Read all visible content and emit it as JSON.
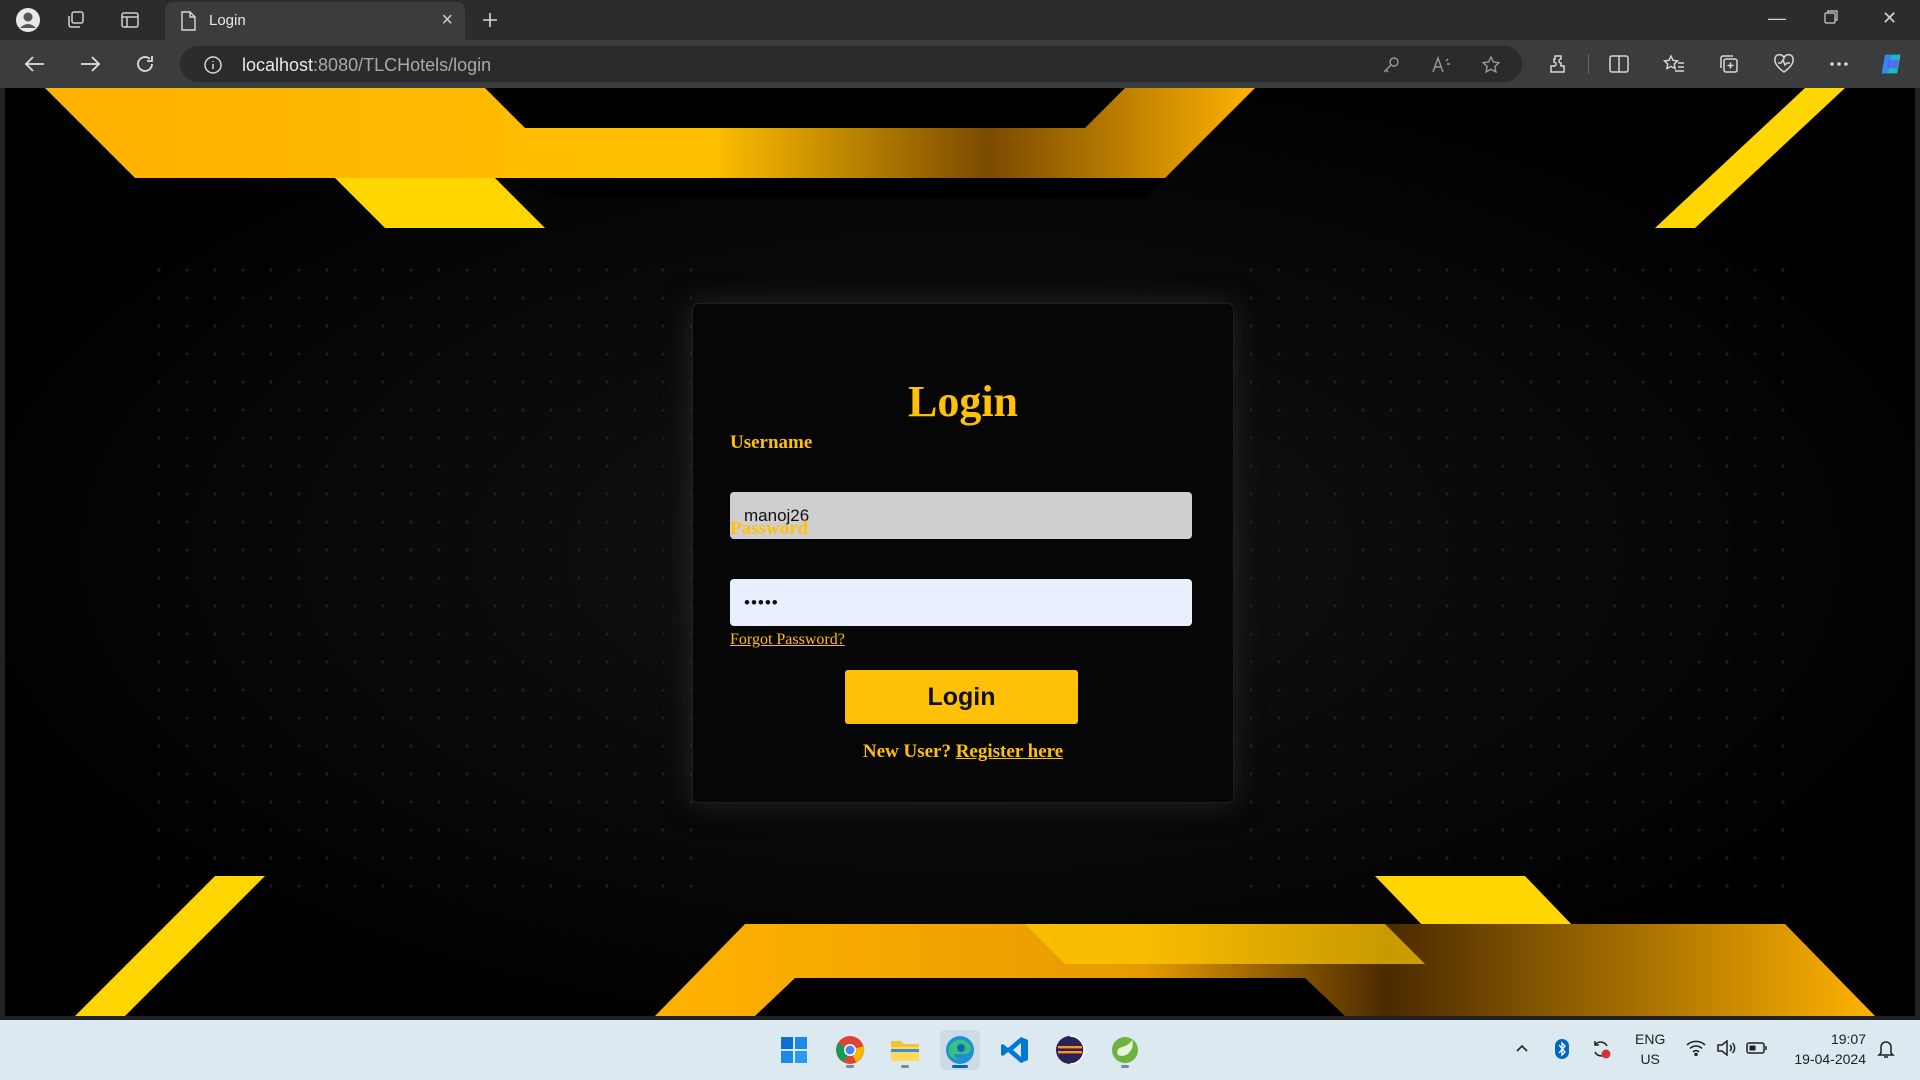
{
  "browser": {
    "tab_title": "Login",
    "url_host": "localhost",
    "url_rest": ":8080/TLCHotels/login"
  },
  "form": {
    "title": "Login",
    "username_label": "Username",
    "username_value": "manoj26",
    "password_label": "Password",
    "password_value": "•••••",
    "forgot_link": "Forgot Password?",
    "login_button": "Login",
    "new_user_text": "New User?",
    "register_link": "Register here"
  },
  "taskbar": {
    "lang_line1": "ENG",
    "lang_line2": "US",
    "time": "19:07",
    "date": "19-04-2024"
  },
  "colors": {
    "accent": "#ffc107",
    "page_background": "#000000"
  }
}
